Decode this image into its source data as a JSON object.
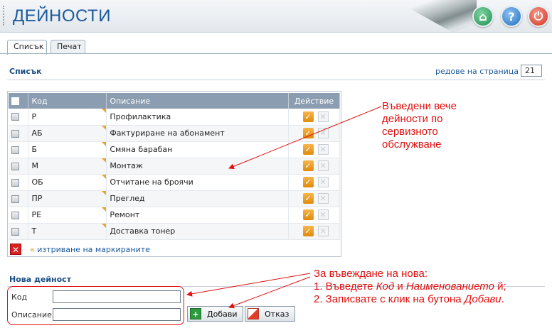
{
  "header": {
    "title": "ДЕЙНОСТИ",
    "buttons": [
      "home",
      "help",
      "power"
    ]
  },
  "tabs": [
    {
      "label": "Списък",
      "active": true
    },
    {
      "label": "Печат",
      "active": false
    }
  ],
  "list": {
    "title": "Списък",
    "rows_per_page_label": "редове на страница",
    "rows_per_page_arrow": "»",
    "rows_per_page_value": "21",
    "columns": [
      "Код",
      "Описание",
      "Действие"
    ],
    "rows": [
      {
        "code": "Р",
        "description": "Профилактика"
      },
      {
        "code": "АБ",
        "description": "Фактуриране на абонамент"
      },
      {
        "code": "Б",
        "description": "Смяна барабан"
      },
      {
        "code": "М",
        "description": "Монтаж"
      },
      {
        "code": "ОБ",
        "description": "Отчитане на броячи"
      },
      {
        "code": "ПР",
        "description": "Преглед"
      },
      {
        "code": "РЕ",
        "description": "Ремонт"
      },
      {
        "code": "Т",
        "description": "Доставка тонер"
      }
    ],
    "bulk_delete_arrow": "«",
    "bulk_delete_label": "изтриване на маркираните"
  },
  "new_activity": {
    "title": "Нова дейност",
    "code_label": "Код",
    "description_label": "Описание",
    "code_value": "",
    "description_value": "",
    "add_label": "Добави",
    "cancel_label": "Отказ"
  },
  "annotations": {
    "list_note": [
      "Въведени вече",
      "дейности по",
      "сервизното",
      "обслужване"
    ],
    "form_note_1": "За въвеждане на нова:",
    "form_note_2_prefix": "1. Въведете ",
    "form_note_2_code": "Код",
    "form_note_2_mid": " и ",
    "form_note_2_name": "Наименованието",
    "form_note_2_suffix": " й;",
    "form_note_3_prefix": "2. Записвате с клик на бутона ",
    "form_note_3_btn": "Добави",
    "form_note_3_suffix": "."
  },
  "colors": {
    "accent": "#1b5a9c",
    "header_row": "#8b9db0",
    "annotation": "#e01010",
    "edit_icon": "#f0a030"
  }
}
